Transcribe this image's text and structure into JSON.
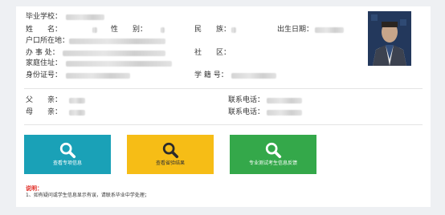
{
  "student": {
    "school_label": "毕业学校：",
    "name_label": "姓　　名：",
    "gender_label": "性　　别：",
    "ethnicity_label": "民　　族：",
    "birth_label": "出生日期：",
    "hukou_label": "户口所在地：",
    "office_label": "办 事 处：",
    "community_label": "社　　区：",
    "address_label": "家庭住址：",
    "id_label": "身份证号：",
    "student_no_label": "学 籍 号："
  },
  "family": {
    "father_label": "父　　亲：",
    "mother_label": "母　　亲：",
    "phone_label_1": "联系电话：",
    "phone_label_2": "联系电话："
  },
  "buttons": [
    {
      "label": "查看专项信息",
      "color": "#1aa1b7",
      "icon": "search-icon"
    },
    {
      "label": "查看省验结果",
      "color": "#f6bd16",
      "icon": "search-icon"
    },
    {
      "label": "专业测试考生信息反馈",
      "color": "#34a84a",
      "icon": "search-icon"
    }
  ],
  "note": {
    "title": "说明：",
    "text": "1、如有疑问或学生信息显示有误，请联系毕业中学处理；"
  },
  "colors": {
    "page_background": "#eef0f3",
    "note_title": "#e0261f"
  }
}
